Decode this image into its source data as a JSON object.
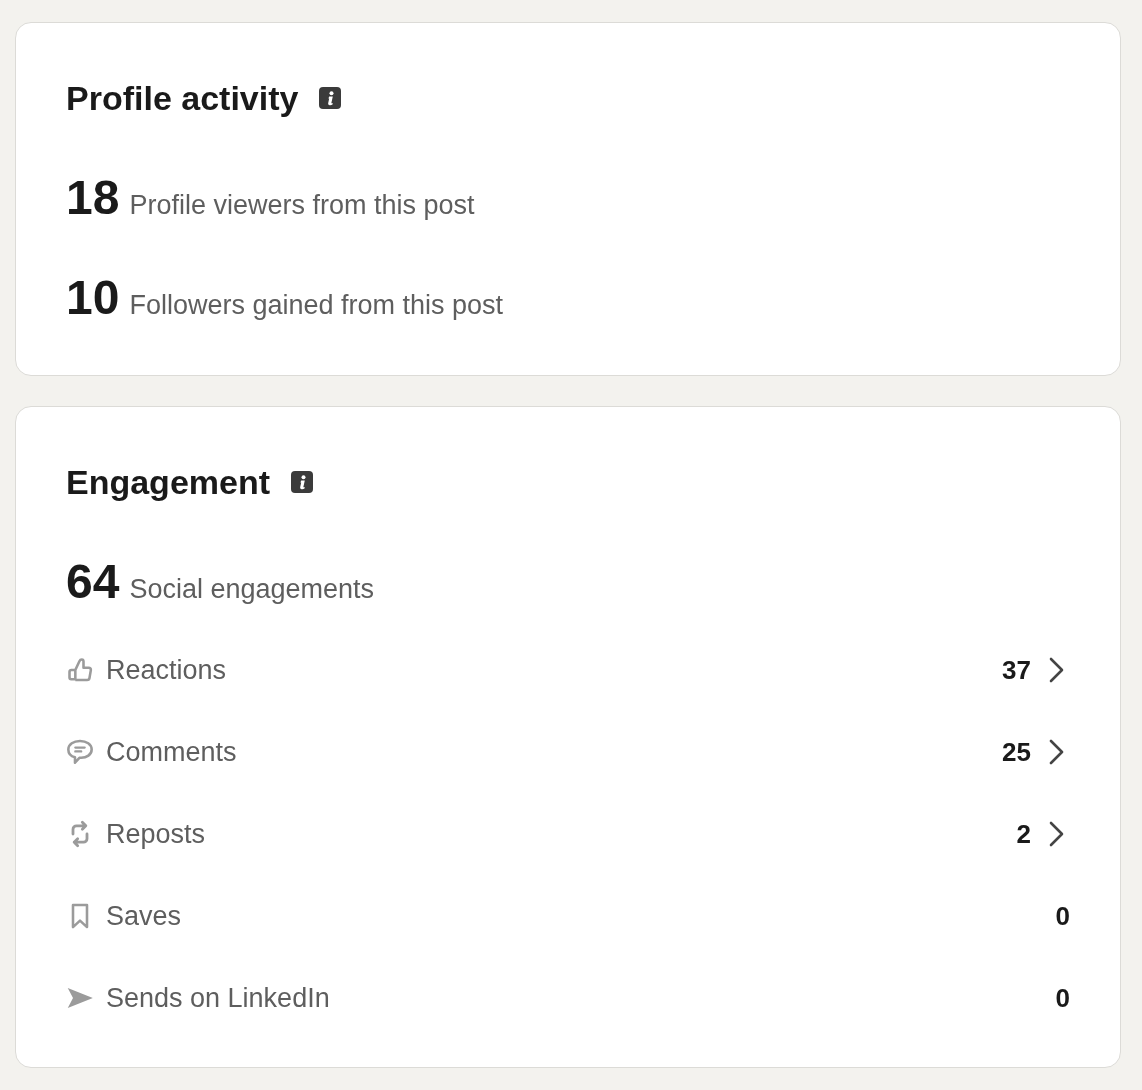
{
  "profile_activity": {
    "title": "Profile activity",
    "stats": [
      {
        "value": "18",
        "label": "Profile viewers from this post"
      },
      {
        "value": "10",
        "label": "Followers gained from this post"
      }
    ]
  },
  "engagement": {
    "title": "Engagement",
    "total": {
      "value": "64",
      "label": "Social engagements"
    },
    "rows": [
      {
        "kind": "reactions",
        "label": "Reactions",
        "count": "37",
        "expandable": true
      },
      {
        "kind": "comments",
        "label": "Comments",
        "count": "25",
        "expandable": true
      },
      {
        "kind": "reposts",
        "label": "Reposts",
        "count": "2",
        "expandable": true
      },
      {
        "kind": "saves",
        "label": "Saves",
        "count": "0",
        "expandable": false
      },
      {
        "kind": "sends",
        "label": "Sends on LinkedIn",
        "count": "0",
        "expandable": false
      }
    ]
  }
}
